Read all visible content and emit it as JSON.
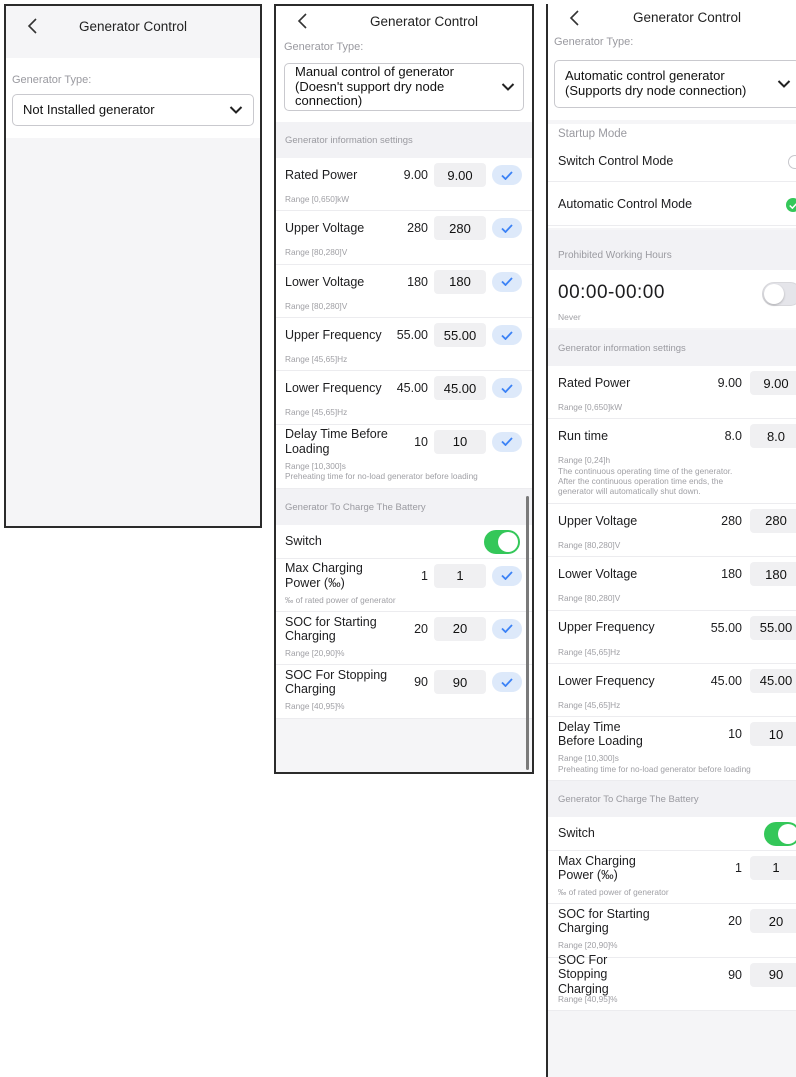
{
  "colors": {
    "accent_check_bg": "#dde9fa",
    "accent_check": "#3b82f6",
    "toggle_on": "#34c759",
    "radio_on": "#34c759"
  },
  "screen1": {
    "title": "Generator Control",
    "generator_type_label": "Generator Type:",
    "generator_type_value": "Not Installed generator"
  },
  "screen2": {
    "title": "Generator Control",
    "generator_type_label": "Generator Type:",
    "generator_type_line1": "Manual control of generator",
    "generator_type_line2": "(Doesn't support dry node connection)",
    "info_section": "Generator information settings",
    "settings": [
      {
        "label": "Rated Power",
        "value": "9.00",
        "input": "9.00",
        "hint": "Range [0,650]kW"
      },
      {
        "label": "Upper Voltage",
        "value": "280",
        "input": "280",
        "hint": "Range [80,280]V"
      },
      {
        "label": "Lower Voltage",
        "value": "180",
        "input": "180",
        "hint": "Range [80,280]V"
      },
      {
        "label": "Upper Frequency",
        "value": "55.00",
        "input": "55.00",
        "hint": "Range [45,65]Hz"
      },
      {
        "label": "Lower Frequency",
        "value": "45.00",
        "input": "45.00",
        "hint": "Range [45,65]Hz"
      },
      {
        "label": "Delay Time Before Loading",
        "value": "10",
        "input": "10",
        "hint": "Range [10,300]s\nPreheating time for no-load generator before loading"
      }
    ],
    "battery_section": "Generator To Charge The Battery",
    "switch_label": "Switch",
    "switch_on": true,
    "charge_settings": [
      {
        "label": "Max Charging Power (‰)",
        "value": "1",
        "input": "1",
        "hint": "‰ of rated power of generator"
      },
      {
        "label": "SOC for Starting Charging",
        "value": "20",
        "input": "20",
        "hint": "Range [20,90]%"
      },
      {
        "label": "SOC For Stopping Charging",
        "value": "90",
        "input": "90",
        "hint": "Range [40,95]%"
      }
    ]
  },
  "screen3": {
    "title": "Generator Control",
    "generator_type_label": "Generator Type:",
    "generator_type_line1": "Automatic control generator",
    "generator_type_line2": "(Supports dry node connection)",
    "startup_mode_label": "Startup Mode",
    "mode_switch": "Switch Control Mode",
    "mode_auto": "Automatic Control Mode",
    "selected_mode": "Automatic Control Mode",
    "prohibited_label": "Prohibited Working Hours",
    "prohibited_time": "00:00-00:00",
    "prohibited_repeat": "Never",
    "prohibited_on": false,
    "info_section": "Generator information settings",
    "settings": [
      {
        "label": "Rated Power",
        "value": "9.00",
        "input": "9.00",
        "hint": "Range [0,650]kW"
      },
      {
        "label": "Run time",
        "value": "8.0",
        "input": "8.0",
        "hint": "Range [0,24]h\nThe continuous operating time of the generator.\nAfter the continuous operation time ends, the\ngenerator will automatically shut down."
      },
      {
        "label": "Upper Voltage",
        "value": "280",
        "input": "280",
        "hint": "Range [80,280]V"
      },
      {
        "label": "Lower Voltage",
        "value": "180",
        "input": "180",
        "hint": "Range [80,280]V"
      },
      {
        "label": "Upper Frequency",
        "value": "55.00",
        "input": "55.00",
        "hint": "Range [45,65]Hz"
      },
      {
        "label": "Lower Frequency",
        "value": "45.00",
        "input": "45.00",
        "hint": "Range [45,65]Hz"
      },
      {
        "label": "Delay Time Before Loading",
        "value": "10",
        "input": "10",
        "hint": "Range [10,300]s\nPreheating time for no-load generator before loading"
      }
    ],
    "battery_section": "Generator To Charge The Battery",
    "switch_label": "Switch",
    "switch_on": true,
    "charge_settings": [
      {
        "label": "Max Charging Power (‰)",
        "value": "1",
        "input": "1",
        "hint": "‰ of rated power of generator"
      },
      {
        "label": "SOC for Starting Charging",
        "value": "20",
        "input": "20",
        "hint": "Range [20,90]%"
      },
      {
        "label": "SOC For Stopping Charging",
        "value": "90",
        "input": "90",
        "hint": "Range [40,95]%"
      }
    ]
  }
}
